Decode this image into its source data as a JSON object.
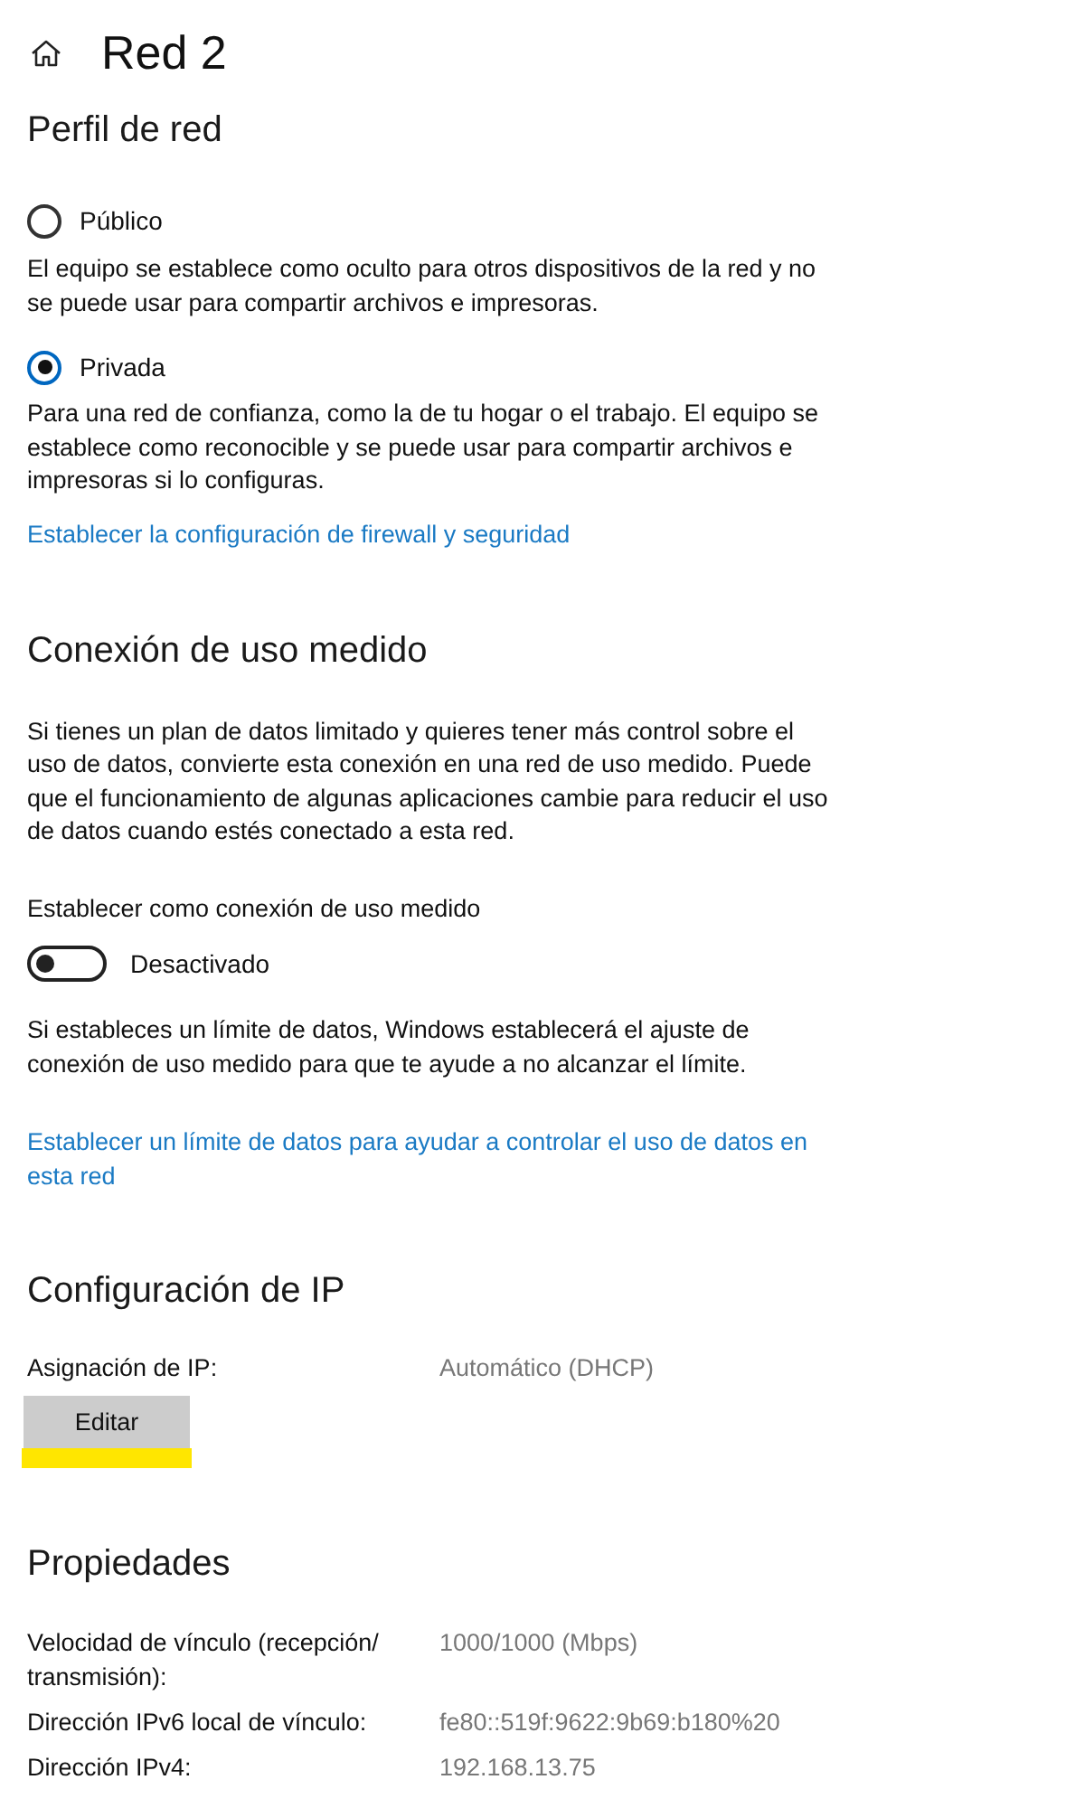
{
  "header": {
    "title": "Red 2"
  },
  "network_profile": {
    "heading": "Perfil de red",
    "options": [
      {
        "label": "Público",
        "selected": false,
        "description": "El equipo se establece como oculto para otros dispositivos de la red y no se puede usar para compartir archivos e impresoras."
      },
      {
        "label": "Privada",
        "selected": true,
        "description": "Para una red de confianza, como la de tu hogar o el trabajo. El equipo se establece como reconocible y se puede usar para compartir archivos e impresoras si lo configuras."
      }
    ],
    "link": "Establecer la configuración de firewall y seguridad"
  },
  "metered_connection": {
    "heading": "Conexión de uso medido",
    "description": "Si tienes un plan de datos limitado y quieres tener más control sobre el uso de datos, convierte esta conexión en una red de uso medido. Puede que el funcionamiento de algunas aplicaciones cambie para reducir el uso de datos cuando estés conectado a esta red.",
    "toggle": {
      "label": "Establecer como conexión de uso medido",
      "on": false,
      "state_text": "Desactivado"
    },
    "note": "Si estableces un límite de datos, Windows establecerá el ajuste de conexión de uso medido para que te ayude a no alcanzar el límite.",
    "link": "Establecer un límite de datos para ayudar a controlar el uso de datos en esta red"
  },
  "ip_settings": {
    "heading": "Configuración de IP",
    "rows": [
      {
        "label": "Asignación de IP:",
        "value": "Automático (DHCP)"
      }
    ],
    "edit_button": {
      "label": "Editar",
      "highlighted": true
    }
  },
  "properties": {
    "heading": "Propiedades",
    "rows": [
      {
        "label": "Velocidad de vínculo (recepción/transmisión):",
        "value": "1000/1000 (Mbps)"
      },
      {
        "label": "Dirección IPv6 local de vínculo:",
        "value": "fe80::519f:9622:9b69:b180%20"
      },
      {
        "label": "Dirección IPv4:",
        "value": "192.168.13.75"
      }
    ]
  }
}
